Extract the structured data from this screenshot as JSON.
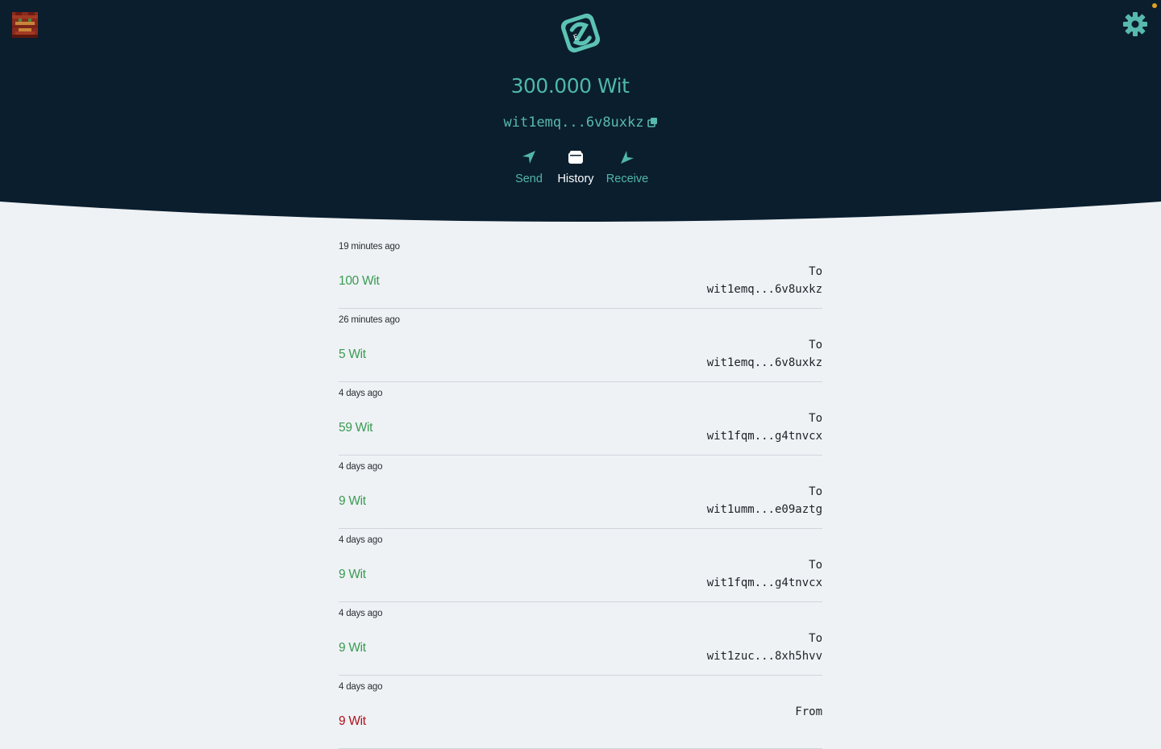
{
  "header": {
    "balance": "300.000 Wit",
    "address": "wit1emq...6v8uxkz",
    "nav": [
      {
        "label": "Send",
        "icon": "send-icon"
      },
      {
        "label": "History",
        "icon": "wallet-icon",
        "active": true
      },
      {
        "label": "Receive",
        "icon": "receive-icon"
      }
    ]
  },
  "icons": {
    "avatar": "pixel-avatar-icon",
    "settings": "gear-icon",
    "logo": "app-logo-icon",
    "copy": "copy-icon"
  },
  "colors": {
    "header_bg": "#0a1e2e",
    "accent": "#4fb8a8",
    "outgoing": "#3a9b52",
    "incoming": "#b0101a",
    "page_bg": "#eef2f5"
  },
  "transactions": [
    {
      "time": "19 minutes ago",
      "amount": "100 Wit",
      "direction": "To",
      "address": "wit1emq...6v8uxkz",
      "type": "out"
    },
    {
      "time": "26 minutes ago",
      "amount": "5 Wit",
      "direction": "To",
      "address": "wit1emq...6v8uxkz",
      "type": "out"
    },
    {
      "time": "4 days ago",
      "amount": "59 Wit",
      "direction": "To",
      "address": "wit1fqm...g4tnvcx",
      "type": "out"
    },
    {
      "time": "4 days ago",
      "amount": "9 Wit",
      "direction": "To",
      "address": "wit1umm...e09aztg",
      "type": "out"
    },
    {
      "time": "4 days ago",
      "amount": "9 Wit",
      "direction": "To",
      "address": "wit1fqm...g4tnvcx",
      "type": "out"
    },
    {
      "time": "4 days ago",
      "amount": "9 Wit",
      "direction": "To",
      "address": "wit1zuc...8xh5hvv",
      "type": "out"
    },
    {
      "time": "4 days ago",
      "amount": "9 Wit",
      "direction": "From",
      "address": "",
      "type": "in"
    }
  ]
}
